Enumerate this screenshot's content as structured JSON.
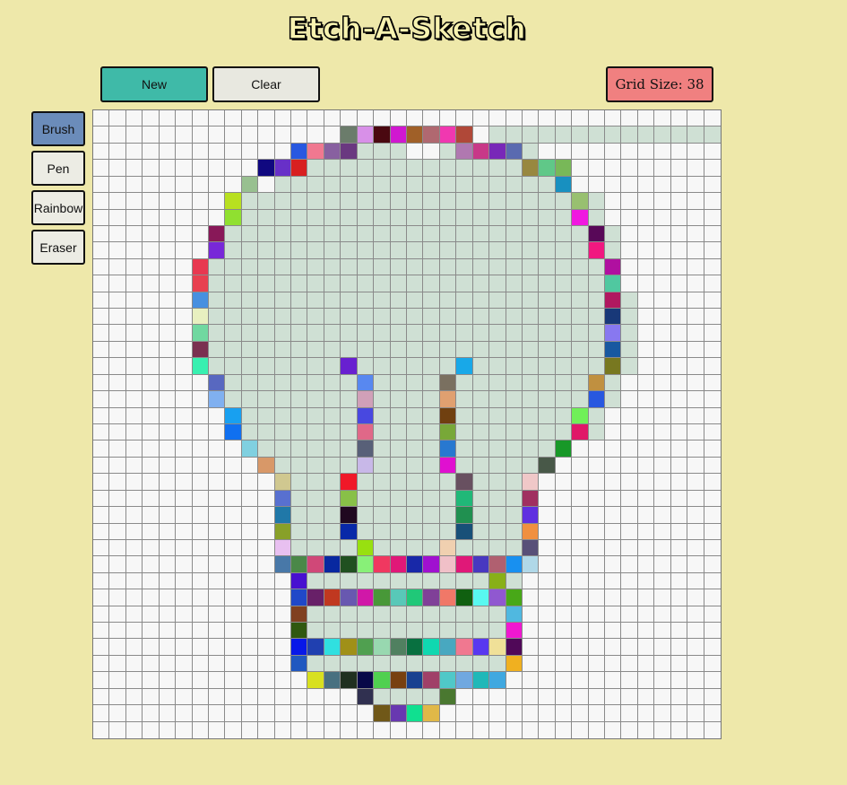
{
  "app": {
    "title": "Etch-A-Sketch"
  },
  "toolbar": {
    "new_label": "New",
    "clear_label": "Clear",
    "grid_size_label": "Grid Size: 38",
    "colors": {
      "new": "#3fbaa8",
      "clear": "#e8e8e0",
      "grid_size": "#f08080"
    }
  },
  "tools": [
    {
      "label": "Brush",
      "active": true
    },
    {
      "label": "Pen",
      "active": false
    },
    {
      "label": "Rainbow",
      "active": false
    },
    {
      "label": "Eraser",
      "active": false
    }
  ],
  "canvas": {
    "grid_size": 38,
    "empty_color": "#f7f7f7",
    "fill_color": "#cfe0d4",
    "rows": [
      {
        "y": 1,
        "runs": [
          [
            16,
            20
          ],
          [
            24,
            38
          ]
        ]
      },
      {
        "y": 2,
        "runs": [
          [
            12,
            18
          ],
          [
            21,
            26
          ]
        ]
      },
      {
        "y": 3,
        "runs": [
          [
            11,
            28
          ]
        ]
      },
      {
        "y": 4,
        "runs": [
          [
            11,
            28
          ]
        ]
      },
      {
        "y": 5,
        "runs": [
          [
            8,
            30
          ]
        ]
      },
      {
        "y": 6,
        "runs": [
          [
            8,
            30
          ]
        ]
      },
      {
        "y": 7,
        "runs": [
          [
            7,
            31
          ]
        ]
      },
      {
        "y": 8,
        "runs": [
          [
            7,
            31
          ]
        ]
      },
      {
        "y": 9,
        "runs": [
          [
            6,
            31
          ]
        ]
      },
      {
        "y": 10,
        "runs": [
          [
            6,
            31
          ]
        ]
      },
      {
        "y": 11,
        "runs": [
          [
            6,
            32
          ]
        ]
      },
      {
        "y": 12,
        "runs": [
          [
            6,
            32
          ]
        ]
      },
      {
        "y": 13,
        "runs": [
          [
            6,
            32
          ]
        ]
      },
      {
        "y": 14,
        "runs": [
          [
            6,
            32
          ]
        ]
      },
      {
        "y": 15,
        "runs": [
          [
            6,
            32
          ]
        ]
      },
      {
        "y": 16,
        "runs": [
          [
            7,
            31
          ]
        ]
      },
      {
        "y": 17,
        "runs": [
          [
            7,
            31
          ]
        ]
      },
      {
        "y": 18,
        "runs": [
          [
            8,
            30
          ]
        ]
      },
      {
        "y": 19,
        "runs": [
          [
            8,
            30
          ]
        ]
      },
      {
        "y": 20,
        "runs": [
          [
            9,
            28
          ]
        ]
      },
      {
        "y": 21,
        "runs": [
          [
            10,
            27
          ]
        ]
      },
      {
        "y": 22,
        "runs": [
          [
            11,
            26
          ]
        ]
      },
      {
        "y": 23,
        "runs": [
          [
            11,
            26
          ]
        ]
      },
      {
        "y": 24,
        "runs": [
          [
            11,
            26
          ]
        ]
      },
      {
        "y": 25,
        "runs": [
          [
            11,
            26
          ]
        ]
      },
      {
        "y": 26,
        "runs": [
          [
            11,
            26
          ]
        ]
      },
      {
        "y": 27,
        "runs": [
          [
            11,
            26
          ]
        ]
      },
      {
        "y": 28,
        "runs": [
          [
            12,
            25
          ]
        ]
      },
      {
        "y": 29,
        "runs": [
          [
            12,
            25
          ]
        ]
      },
      {
        "y": 30,
        "runs": [
          [
            12,
            25
          ]
        ]
      },
      {
        "y": 31,
        "runs": [
          [
            12,
            25
          ]
        ]
      },
      {
        "y": 32,
        "runs": [
          [
            12,
            25
          ]
        ]
      },
      {
        "y": 33,
        "runs": [
          [
            12,
            25
          ]
        ]
      },
      {
        "y": 34,
        "runs": [
          [
            13,
            24
          ]
        ]
      },
      {
        "y": 35,
        "runs": [
          [
            16,
            21
          ]
        ]
      },
      {
        "y": 36,
        "runs": [
          [
            17,
            20
          ]
        ]
      }
    ],
    "painted": [
      [
        15,
        1,
        "#6b7c6b"
      ],
      [
        16,
        1,
        "#d890e8"
      ],
      [
        17,
        1,
        "#4a0810"
      ],
      [
        18,
        1,
        "#d018d0"
      ],
      [
        19,
        1,
        "#a06028"
      ],
      [
        20,
        1,
        "#b06870"
      ],
      [
        21,
        1,
        "#f038b0"
      ],
      [
        22,
        1,
        "#b04838"
      ],
      [
        12,
        2,
        "#2858e0"
      ],
      [
        13,
        2,
        "#f07890"
      ],
      [
        14,
        2,
        "#8860a0"
      ],
      [
        15,
        2,
        "#6a3880"
      ],
      [
        22,
        2,
        "#b078b0"
      ],
      [
        23,
        2,
        "#c83888"
      ],
      [
        24,
        2,
        "#7828b8"
      ],
      [
        25,
        2,
        "#5a6ab0"
      ],
      [
        10,
        3,
        "#100880"
      ],
      [
        11,
        3,
        "#6830c8"
      ],
      [
        12,
        3,
        "#d82020"
      ],
      [
        26,
        3,
        "#988840"
      ],
      [
        27,
        3,
        "#60c888"
      ],
      [
        28,
        3,
        "#78b858"
      ],
      [
        9,
        4,
        "#98c090"
      ],
      [
        28,
        4,
        "#1890c0"
      ],
      [
        8,
        5,
        "#b8e020"
      ],
      [
        29,
        5,
        "#98c070"
      ],
      [
        8,
        6,
        "#90e030"
      ],
      [
        29,
        6,
        "#f018e0"
      ],
      [
        7,
        7,
        "#881858"
      ],
      [
        30,
        7,
        "#580858"
      ],
      [
        7,
        8,
        "#7828d8"
      ],
      [
        30,
        8,
        "#f01880"
      ],
      [
        6,
        9,
        "#e83850"
      ],
      [
        31,
        9,
        "#b010a0"
      ],
      [
        6,
        10,
        "#e84050"
      ],
      [
        31,
        10,
        "#50c8a0"
      ],
      [
        6,
        11,
        "#4890e0"
      ],
      [
        31,
        11,
        "#b01860"
      ],
      [
        6,
        12,
        "#e8f0c0"
      ],
      [
        31,
        12,
        "#183878"
      ],
      [
        6,
        13,
        "#70d8a0"
      ],
      [
        31,
        13,
        "#8878f0"
      ],
      [
        6,
        14,
        "#7a3050"
      ],
      [
        31,
        14,
        "#1858a0"
      ],
      [
        6,
        15,
        "#38f0b0"
      ],
      [
        15,
        15,
        "#6820d0"
      ],
      [
        22,
        15,
        "#18a8e8"
      ],
      [
        31,
        15,
        "#787820"
      ],
      [
        7,
        16,
        "#5868c0"
      ],
      [
        16,
        16,
        "#5888f0"
      ],
      [
        21,
        16,
        "#7a7060"
      ],
      [
        30,
        16,
        "#c09040"
      ],
      [
        7,
        17,
        "#80b0f0"
      ],
      [
        16,
        17,
        "#d0a0b8"
      ],
      [
        21,
        17,
        "#e0a070"
      ],
      [
        30,
        17,
        "#2858e0"
      ],
      [
        8,
        18,
        "#18a0f0"
      ],
      [
        16,
        18,
        "#4848e0"
      ],
      [
        21,
        18,
        "#704010"
      ],
      [
        29,
        18,
        "#70f058"
      ],
      [
        8,
        19,
        "#1070f0"
      ],
      [
        16,
        19,
        "#e06888"
      ],
      [
        21,
        19,
        "#78a838"
      ],
      [
        29,
        19,
        "#e01868"
      ],
      [
        9,
        20,
        "#80d0e0"
      ],
      [
        16,
        20,
        "#586078"
      ],
      [
        21,
        20,
        "#2878d0"
      ],
      [
        28,
        20,
        "#189828"
      ],
      [
        10,
        21,
        "#d89868"
      ],
      [
        16,
        21,
        "#c8b8e8"
      ],
      [
        21,
        21,
        "#e010d0"
      ],
      [
        27,
        21,
        "#485848"
      ],
      [
        11,
        22,
        "#d0c890"
      ],
      [
        15,
        22,
        "#f01828"
      ],
      [
        22,
        22,
        "#685060"
      ],
      [
        26,
        22,
        "#f0c8c8"
      ],
      [
        11,
        23,
        "#5870d0"
      ],
      [
        15,
        23,
        "#88c048"
      ],
      [
        22,
        23,
        "#20b878"
      ],
      [
        26,
        23,
        "#a03060"
      ],
      [
        11,
        24,
        "#2078a8"
      ],
      [
        15,
        24,
        "#200820"
      ],
      [
        22,
        24,
        "#209050"
      ],
      [
        26,
        24,
        "#6030e0"
      ],
      [
        11,
        25,
        "#88a028"
      ],
      [
        15,
        25,
        "#0828a8"
      ],
      [
        22,
        25,
        "#185078"
      ],
      [
        26,
        25,
        "#f09040"
      ],
      [
        11,
        26,
        "#e8c0f0"
      ],
      [
        16,
        26,
        "#98e010"
      ],
      [
        21,
        26,
        "#f0d0b0"
      ],
      [
        26,
        26,
        "#585078"
      ],
      [
        11,
        27,
        "#4878a8"
      ],
      [
        12,
        27,
        "#4a8848"
      ],
      [
        13,
        27,
        "#d04878"
      ],
      [
        14,
        27,
        "#0828a0"
      ],
      [
        15,
        27,
        "#205020"
      ],
      [
        16,
        27,
        "#88f078"
      ],
      [
        17,
        27,
        "#f03860"
      ],
      [
        18,
        27,
        "#e01878"
      ],
      [
        19,
        27,
        "#1828a8"
      ],
      [
        20,
        27,
        "#a010d0"
      ],
      [
        21,
        27,
        "#f0c0c8"
      ],
      [
        22,
        27,
        "#e01878"
      ],
      [
        23,
        27,
        "#4838c0"
      ],
      [
        24,
        27,
        "#b06070"
      ],
      [
        25,
        27,
        "#1890f0"
      ],
      [
        26,
        27,
        "#b0d8e8"
      ],
      [
        12,
        28,
        "#4810d0"
      ],
      [
        24,
        28,
        "#88b018"
      ],
      [
        12,
        29,
        "#2048c8"
      ],
      [
        13,
        29,
        "#682068"
      ],
      [
        14,
        29,
        "#c03820"
      ],
      [
        15,
        29,
        "#6858b0"
      ],
      [
        16,
        29,
        "#d018a8"
      ],
      [
        17,
        29,
        "#489838"
      ],
      [
        18,
        29,
        "#58c8b8"
      ],
      [
        19,
        29,
        "#20c878"
      ],
      [
        20,
        29,
        "#804098"
      ],
      [
        21,
        29,
        "#f07868"
      ],
      [
        22,
        29,
        "#106010"
      ],
      [
        23,
        29,
        "#58f8f0"
      ],
      [
        24,
        29,
        "#9058d0"
      ],
      [
        25,
        29,
        "#48a818"
      ],
      [
        12,
        30,
        "#804020"
      ],
      [
        25,
        30,
        "#50b8e0"
      ],
      [
        12,
        31,
        "#305810"
      ],
      [
        25,
        31,
        "#f018d0"
      ],
      [
        12,
        32,
        "#0818e8"
      ],
      [
        13,
        32,
        "#2040b0"
      ],
      [
        14,
        32,
        "#30e0e0"
      ],
      [
        15,
        32,
        "#a09018"
      ],
      [
        16,
        32,
        "#50a050"
      ],
      [
        17,
        32,
        "#98d8b0"
      ],
      [
        18,
        32,
        "#508060"
      ],
      [
        19,
        32,
        "#087040"
      ],
      [
        20,
        32,
        "#10d8b0"
      ],
      [
        21,
        32,
        "#48a8c0"
      ],
      [
        22,
        32,
        "#f07890"
      ],
      [
        23,
        32,
        "#5838f0"
      ],
      [
        24,
        32,
        "#f0e098"
      ],
      [
        25,
        32,
        "#500858"
      ],
      [
        12,
        33,
        "#2058c0"
      ],
      [
        25,
        33,
        "#f0b020"
      ],
      [
        13,
        34,
        "#d8e020"
      ],
      [
        14,
        34,
        "#487080"
      ],
      [
        15,
        34,
        "#203020"
      ],
      [
        16,
        34,
        "#080848"
      ],
      [
        17,
        34,
        "#50d050"
      ],
      [
        18,
        34,
        "#784010"
      ],
      [
        19,
        34,
        "#184090"
      ],
      [
        20,
        34,
        "#a04068"
      ],
      [
        21,
        34,
        "#50c8c8"
      ],
      [
        22,
        34,
        "#70a8e0"
      ],
      [
        23,
        34,
        "#20b8b8"
      ],
      [
        24,
        34,
        "#40a8e0"
      ],
      [
        16,
        35,
        "#303050"
      ],
      [
        21,
        35,
        "#4a7830"
      ],
      [
        17,
        36,
        "#705818"
      ],
      [
        18,
        36,
        "#6838b0"
      ],
      [
        19,
        36,
        "#10e090"
      ],
      [
        20,
        36,
        "#e0b848"
      ]
    ]
  }
}
